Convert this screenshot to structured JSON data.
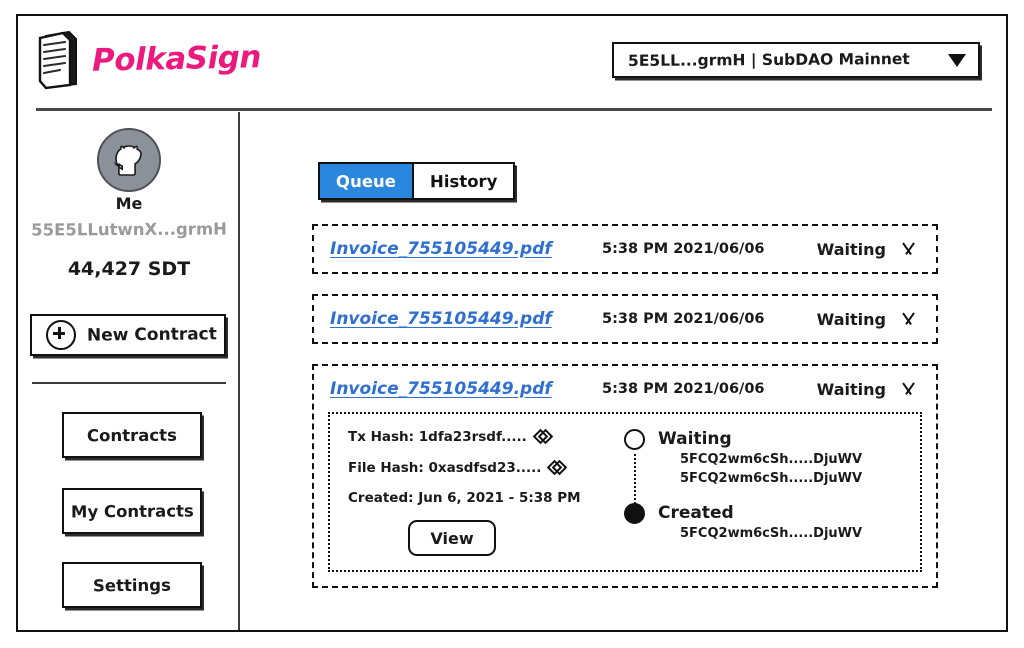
{
  "header": {
    "brand_name": "PolkaSign",
    "logo_icon": "document-stack-icon",
    "account_selector": {
      "value": "5E5LL...grmH | SubDAO Mainnet",
      "caret_icon": "caret-down-icon"
    }
  },
  "sidebar": {
    "avatar_icon": "github-octocat-avatar",
    "profile_label": "Me",
    "address": "55E5LLutwnX...grmH",
    "balance": "44,427 SDT",
    "new_contract": {
      "label": "New Contract",
      "icon": "plus-circle-icon"
    },
    "nav_items": [
      {
        "label": "Contracts"
      },
      {
        "label": "My Contracts"
      },
      {
        "label": "Settings"
      }
    ]
  },
  "main": {
    "tabs": [
      {
        "label": "Queue",
        "active": true
      },
      {
        "label": "History",
        "active": false
      }
    ],
    "documents": [
      {
        "file_name": "Invoice_755105449.pdf",
        "timestamp": "5:38 PM 2021/06/06",
        "status": "Waiting",
        "chevron_icon": "chevron-down-icon",
        "expanded": false
      },
      {
        "file_name": "Invoice_755105449.pdf",
        "timestamp": "5:38 PM 2021/06/06",
        "status": "Waiting",
        "chevron_icon": "chevron-down-icon",
        "expanded": false
      },
      {
        "file_name": "Invoice_755105449.pdf",
        "timestamp": "5:38 PM 2021/06/06",
        "status": "Waiting",
        "chevron_icon": "chevron-down-icon",
        "expanded": true,
        "detail": {
          "tx_hash_label": "Tx Hash: 1dfa23rsdf.....",
          "tx_hash_copy_icon": "copy-icon",
          "file_hash_label": "File Hash: 0xasdfsd23.....",
          "file_hash_copy_icon": "copy-icon",
          "created_label": "Created: Jun 6, 2021 - 5:38 PM",
          "view_button": "View",
          "timeline": [
            {
              "title": "Waiting",
              "dot": "hollow",
              "addresses": [
                "5FCQ2wm6cSh.....DjuWV",
                "5FCQ2wm6cSh.....DjuWV"
              ]
            },
            {
              "title": "Created",
              "dot": "filled",
              "addresses": [
                "5FCQ2wm6cSh.....DjuWV"
              ]
            }
          ]
        }
      }
    ]
  },
  "colors": {
    "brand_pink": "#ec1a7f",
    "tab_active_blue": "#2b87dd",
    "link_blue": "#2f6fd0",
    "address_gray": "#9a9a9a",
    "avatar_gray": "#8b9198"
  }
}
